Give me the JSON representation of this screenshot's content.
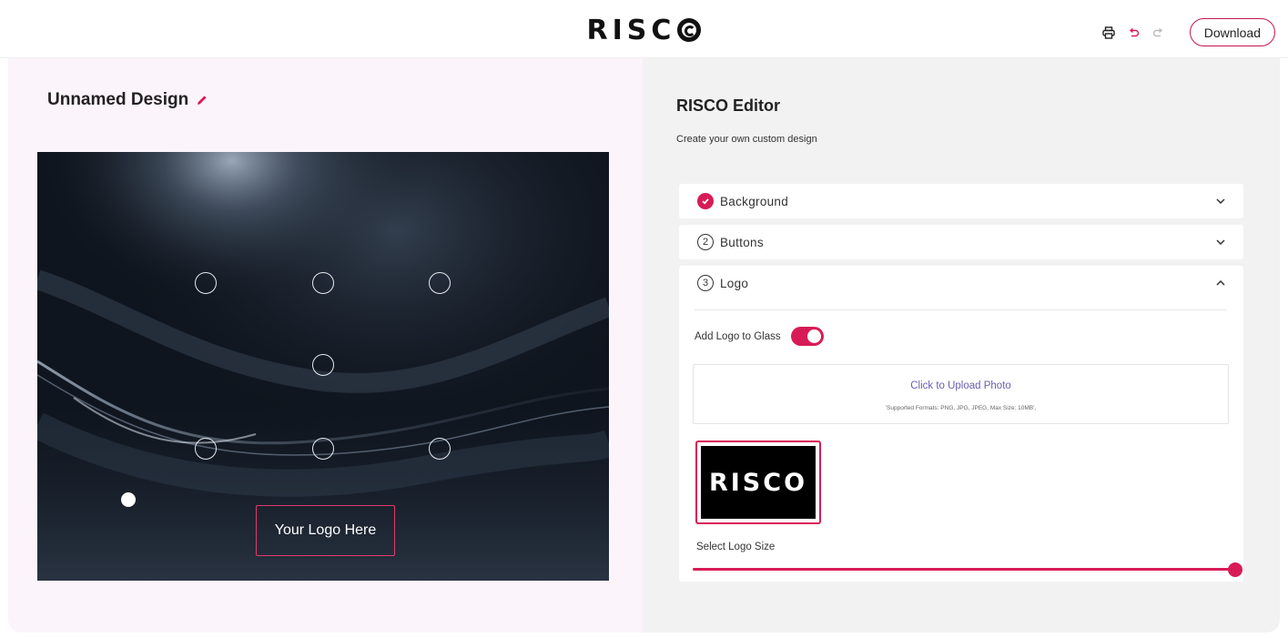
{
  "header": {
    "brand": "RISC",
    "print_icon": "printer-icon",
    "undo_icon": "undo-icon",
    "redo_icon": "redo-icon",
    "download_label": "Download"
  },
  "design": {
    "title": "Unnamed Design",
    "edit_icon": "pencil-icon"
  },
  "canvas": {
    "logo_placeholder": "Your Logo Here",
    "button_count": 7
  },
  "editor": {
    "title": "RISCO Editor",
    "subtitle": "Create your own custom design",
    "sections": [
      {
        "label": "Background",
        "step": "1",
        "completed": true,
        "expanded": false
      },
      {
        "label": "Buttons",
        "step": "2",
        "completed": false,
        "expanded": false
      },
      {
        "label": "Logo",
        "step": "3",
        "completed": false,
        "expanded": true
      }
    ],
    "logo": {
      "toggle_label": "Add Logo to Glass",
      "toggle_on": true,
      "upload_link": "Click to Upload Photo",
      "upload_note": "'Supported Formats: PNG, JPG, JPEG, Max Size: 10MB',",
      "thumbnail_text": "RISCO",
      "size_label": "Select Logo Size",
      "size_value": 1.0
    }
  },
  "colors": {
    "accent": "#d81b56",
    "left_panel_bg": "#fcf4fb",
    "right_panel_bg": "#f2f2f2",
    "upload_link": "#6a5db0"
  }
}
